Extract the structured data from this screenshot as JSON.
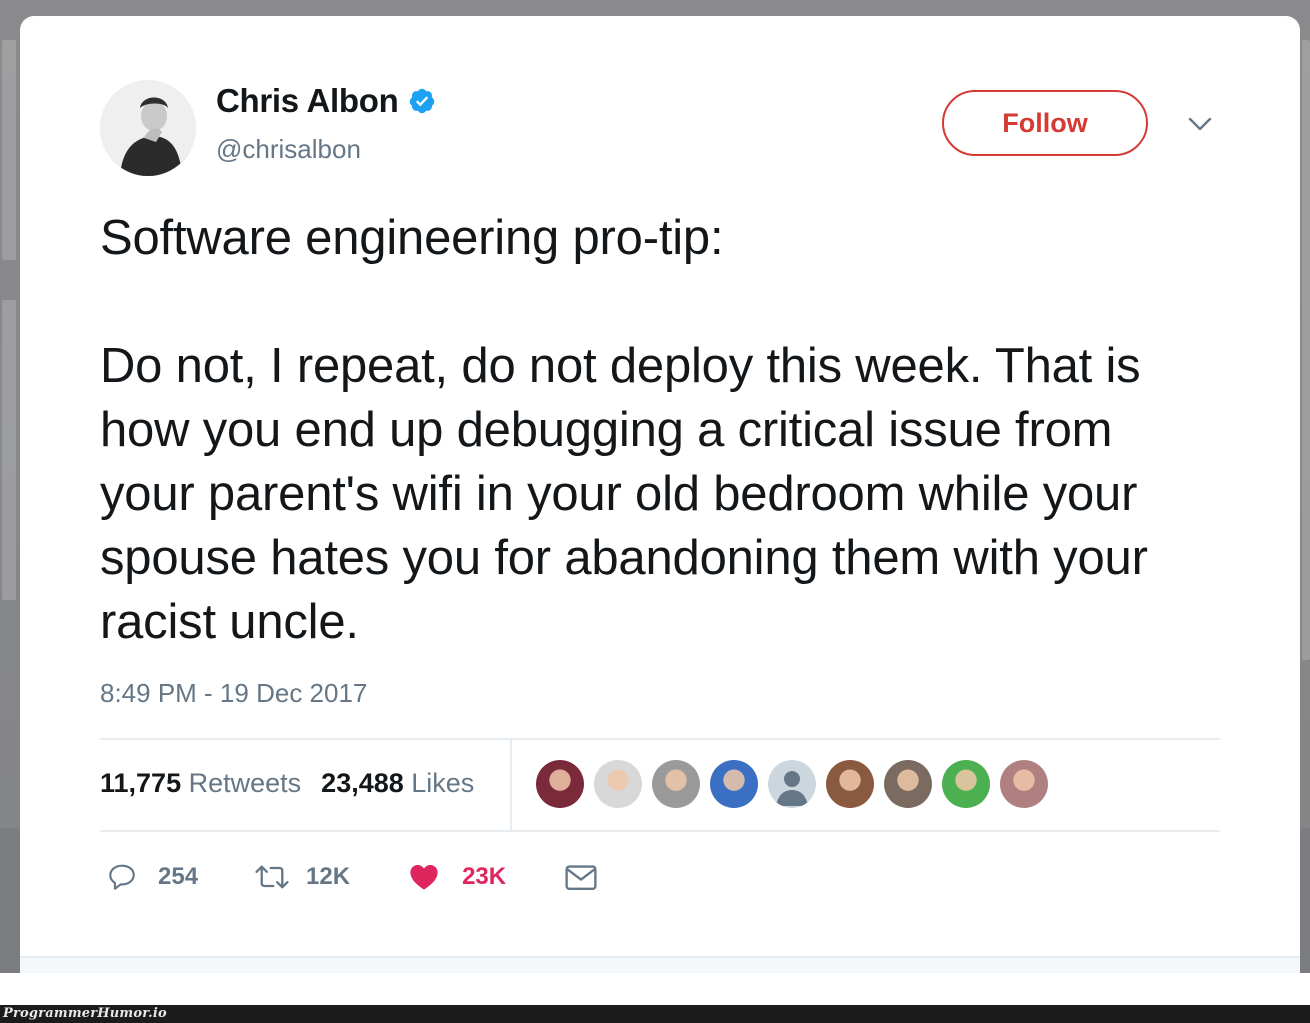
{
  "user": {
    "name": "Chris Albon",
    "handle": "@chrisalbon",
    "verified": true,
    "avatar_icon": "profile-photo"
  },
  "header": {
    "follow_label": "Follow",
    "more_icon": "chevron-down-icon"
  },
  "tweet": {
    "text": "Software engineering pro-tip:\n\nDo not, I repeat, do not deploy this week. That is how you end up debugging a critical issue from your parent's wifi in your old bedroom while your spouse hates you for abandoning them with your racist uncle.",
    "timestamp": "8:49 PM - 19 Dec 2017"
  },
  "stats": {
    "retweets_count": "11,775",
    "retweets_label": "Retweets",
    "likes_count": "23,488",
    "likes_label": "Likes"
  },
  "likers": [
    {
      "name": "liker-1",
      "color": "#7a2a3a"
    },
    {
      "name": "liker-2",
      "color": "#d8d8d8"
    },
    {
      "name": "liker-3",
      "color": "#9a9a9a"
    },
    {
      "name": "liker-4",
      "color": "#3a6fc4"
    },
    {
      "name": "liker-5",
      "color": "#ccd6dd"
    },
    {
      "name": "liker-6",
      "color": "#8a5a40"
    },
    {
      "name": "liker-7",
      "color": "#7a6a60"
    },
    {
      "name": "liker-8",
      "color": "#4caf50"
    },
    {
      "name": "liker-9",
      "color": "#b08080"
    }
  ],
  "actions": {
    "reply_count": "254",
    "retweet_count": "12K",
    "like_count": "23K",
    "like_color": "#e0245e",
    "icon_color": "#657786"
  },
  "watermark": "ProgrammerHumor.io"
}
